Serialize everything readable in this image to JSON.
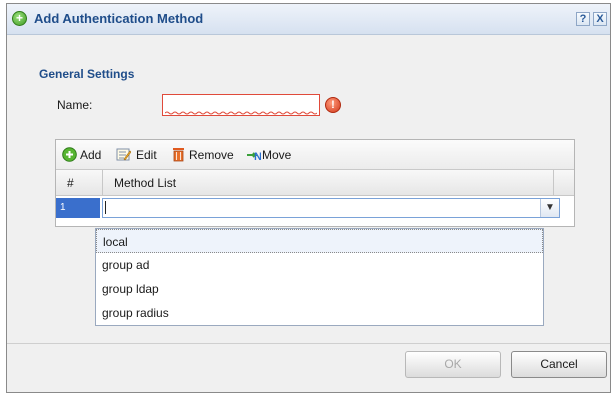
{
  "dialog": {
    "title": "Add Authentication Method",
    "help_label": "?",
    "close_label": "X"
  },
  "general": {
    "section_title": "General Settings",
    "name_label": "Name:",
    "name_value": "",
    "error_glyph": "!"
  },
  "toolbar": {
    "add_label": "Add",
    "edit_label": "Edit",
    "remove_label": "Remove",
    "move_label": "Move"
  },
  "table": {
    "columns": [
      "#",
      "Method List"
    ],
    "rows": [
      {
        "num": "1",
        "method": ""
      }
    ]
  },
  "dropdown": {
    "options": [
      "local",
      "group ad",
      "group ldap",
      "group radius"
    ],
    "highlighted": "local"
  },
  "footer": {
    "ok_label": "OK",
    "cancel_label": "Cancel"
  },
  "colors": {
    "title_text": "#1f4d8a",
    "error": "#d23a1c",
    "selected_row": "#3a6fcc"
  },
  "icons": {
    "title": "add-circle-icon",
    "help": "help-icon",
    "close": "close-icon",
    "error": "error-icon",
    "add": "add-icon",
    "edit": "edit-icon",
    "remove": "trash-icon",
    "move": "move-icon",
    "dropdown": "chevron-down-icon"
  }
}
